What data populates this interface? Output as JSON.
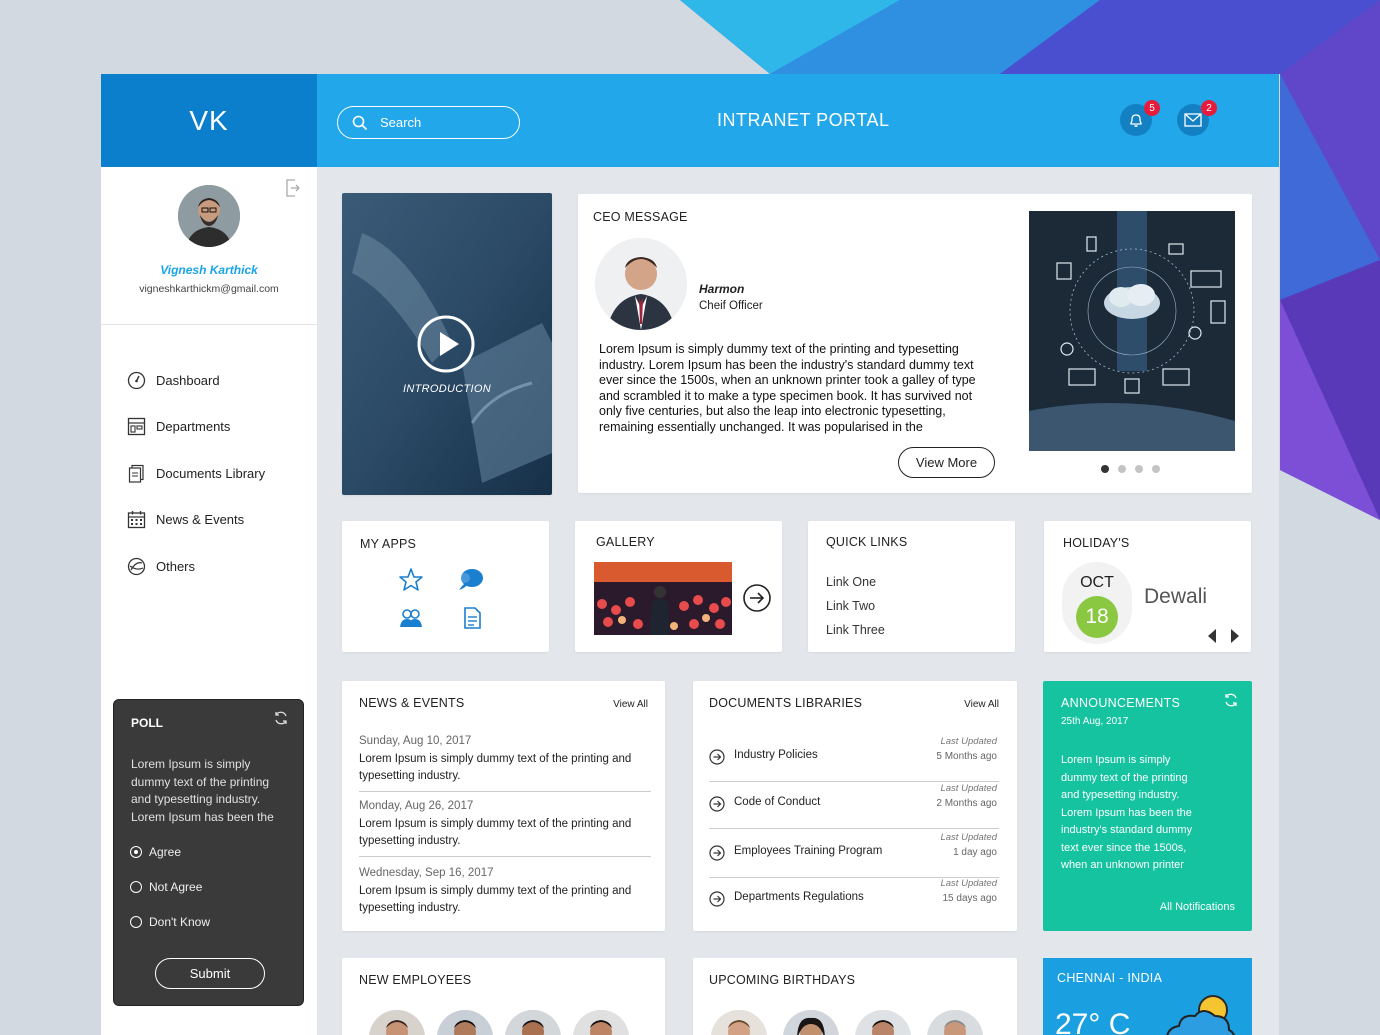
{
  "brand": "VK",
  "header": {
    "search_placeholder": "Search",
    "title": "INTRANET PORTAL",
    "notifications_count": "5",
    "messages_count": "2"
  },
  "profile": {
    "name": "Vignesh Karthick",
    "email": "vigneshkarthickm@gmail.com"
  },
  "nav": [
    {
      "label": "Dashboard",
      "icon": "dashboard-icon"
    },
    {
      "label": "Departments",
      "icon": "departments-icon"
    },
    {
      "label": "Documents Library",
      "icon": "documents-icon"
    },
    {
      "label": "News & Events",
      "icon": "calendar-icon"
    },
    {
      "label": "Others",
      "icon": "others-icon"
    }
  ],
  "poll": {
    "title": "POLL",
    "text": "Lorem Ipsum is simply dummy text of the printing and typesetting industry. Lorem Ipsum has been the",
    "options": [
      "Agree",
      "Not Agree",
      "Don't Know"
    ],
    "selected": "Agree",
    "submit": "Submit"
  },
  "video": {
    "label": "INTRODUCTION"
  },
  "ceo": {
    "title": "CEO MESSAGE",
    "name": "Harmon",
    "role": "Cheif Officer",
    "message": "Lorem Ipsum is simply dummy text of the printing and typesetting industry. Lorem Ipsum has been the industry's standard dummy text ever since the 1500s, when an unknown printer took a galley of type and scrambled it to make a type specimen book. It has survived not only five centuries, but also the leap into electronic typesetting, remaining essentially unchanged. It was popularised in the",
    "view_more": "View More",
    "slides": 4,
    "active_slide": 1
  },
  "my_apps": {
    "title": "MY APPS",
    "apps": [
      "star-icon",
      "chat-icon",
      "users-icon",
      "document-icon"
    ]
  },
  "gallery": {
    "title": "GALLERY"
  },
  "quick_links": {
    "title": "QUICK LINKS",
    "links": [
      "Link One",
      "Link Two",
      "Link Three"
    ]
  },
  "holidays": {
    "title": "HOLIDAY'S",
    "month": "OCT",
    "day": "18",
    "name": "Dewali"
  },
  "news": {
    "title": "NEWS & EVENTS",
    "view_all": "View All",
    "items": [
      {
        "date": "Sunday, Aug 10, 2017",
        "text": "Lorem Ipsum is simply dummy text of the printing and typesetting industry."
      },
      {
        "date": "Monday, Aug 26, 2017",
        "text": "Lorem Ipsum is simply dummy text of the printing and typesetting industry."
      },
      {
        "date": "Wednesday, Sep 16, 2017",
        "text": "Lorem Ipsum is simply dummy text of the printing and typesetting industry."
      }
    ]
  },
  "docs": {
    "title": "DOCUMENTS LIBRARIES",
    "view_all": "View All",
    "items": [
      {
        "name": "Industry Policies",
        "label": "Last Updated",
        "ago": "5 Months ago"
      },
      {
        "name": "Code of Conduct",
        "label": "Last Updated",
        "ago": "2 Months ago"
      },
      {
        "name": "Employees Training Program",
        "label": "Last Updated",
        "ago": "1 day ago"
      },
      {
        "name": "Departments Regulations",
        "label": "Last Updated",
        "ago": "15 days ago"
      }
    ]
  },
  "announcements": {
    "title": "ANNOUNCEMENTS",
    "date": "25th Aug, 2017",
    "text": "Lorem Ipsum is simply dummy text of the printing and typesetting industry. Lorem Ipsum has been the industry's standard dummy text ever since the 1500s, when an unknown printer",
    "all": "All Notifications"
  },
  "new_employees": {
    "title": "NEW EMPLOYEES"
  },
  "birthdays": {
    "title": "UPCOMING BIRTHDAYS"
  },
  "weather": {
    "city": "CHENNAI - INDIA",
    "temp": "27° C"
  },
  "colors": {
    "brand_dark": "#0c7fcc",
    "brand": "#22a7ea",
    "accent_green": "#15c3a0",
    "badge_red": "#e81a3b",
    "holiday_green": "#8ac842"
  }
}
